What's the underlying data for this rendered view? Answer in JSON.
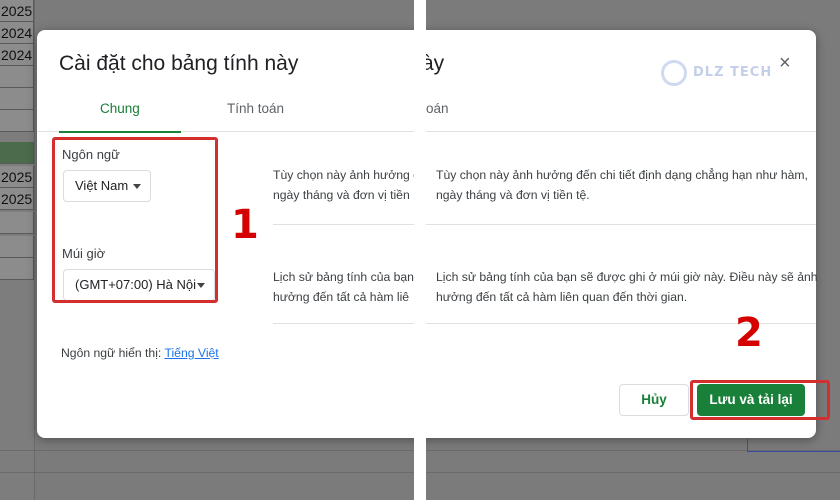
{
  "left_panel": {
    "sheet_cells": [
      "2025",
      "2024",
      "2024",
      "2025",
      "2025"
    ],
    "dialog_title": "Cài đặt cho bảng tính này",
    "tabs": [
      "Chung",
      "Tính toán"
    ],
    "language_label": "Ngôn ngữ",
    "language_value": "Việt Nam",
    "timezone_label": "Múi giờ",
    "timezone_value": "(GMT+07:00) Hà Nội",
    "desc_language_line1": "Tùy chọn này ảnh hưởng đ",
    "desc_language_line2": "ngày tháng và đơn vị tiền",
    "desc_timezone_line1": "Lịch sử bảng tính của bạn",
    "desc_timezone_line2": "hưởng đến tất cả hàm liê",
    "display_language_label": "Ngôn ngữ hiển thị:",
    "display_language_link": "Tiếng Việt",
    "step_number": "1"
  },
  "right_panel": {
    "title_fragment": "ày",
    "tab_fragment": "oán",
    "desc_language_line1": "Tùy chọn này ảnh hưởng đến chi tiết định dạng chẳng hạn như hàm,",
    "desc_language_line2": "ngày tháng và đơn vị tiền tệ.",
    "desc_timezone_line1": "Lịch sử bảng tính của bạn sẽ được ghi ở múi giờ này. Điều này sẽ ảnh",
    "desc_timezone_line2": "hưởng đến tất cả hàm liên quan đến thời gian.",
    "cancel_label": "Hủy",
    "save_label": "Lưu và tải lại",
    "step_number": "2",
    "watermark_text": "DLZ TECH",
    "close_symbol": "×"
  },
  "colors": {
    "accent_green": "#188038",
    "highlight_red": "#d32f2f",
    "link_blue": "#1a73e8"
  }
}
